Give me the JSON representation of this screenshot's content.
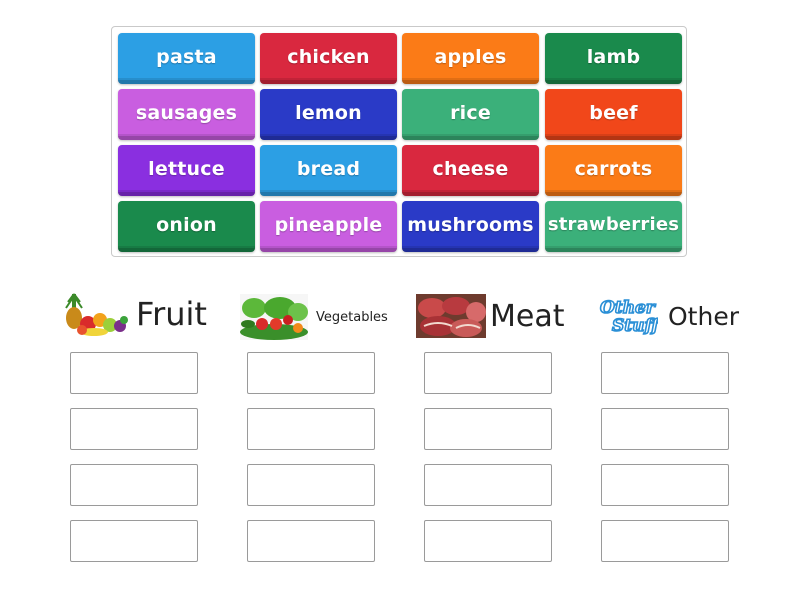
{
  "tiles": [
    {
      "label": "pasta",
      "color": "#2c9fe4"
    },
    {
      "label": "chicken",
      "color": "#d9283f"
    },
    {
      "label": "apples",
      "color": "#fb7b17"
    },
    {
      "label": "lamb",
      "color": "#1a8a4c"
    },
    {
      "label": "sausages",
      "color": "#c95ee0"
    },
    {
      "label": "lemon",
      "color": "#2a3ac7"
    },
    {
      "label": "rice",
      "color": "#3bb07a"
    },
    {
      "label": "beef",
      "color": "#f1471a"
    },
    {
      "label": "lettuce",
      "color": "#8a2fe0"
    },
    {
      "label": "bread",
      "color": "#2c9fe4"
    },
    {
      "label": "cheese",
      "color": "#d9283f"
    },
    {
      "label": "carrots",
      "color": "#fb7b17"
    },
    {
      "label": "onion",
      "color": "#1a8a4c"
    },
    {
      "label": "pineapple",
      "color": "#c95ee0"
    },
    {
      "label": "mushrooms",
      "color": "#2a3ac7"
    },
    {
      "label": "strawberries",
      "color": "#3bb07a"
    }
  ],
  "categories": [
    {
      "label": "Fruit",
      "icon": "fruit-image"
    },
    {
      "label": "Vegetables",
      "icon": "vegetables-image"
    },
    {
      "label": "Meat",
      "icon": "meat-image"
    },
    {
      "label": "Other",
      "icon": "other-stuff-logo",
      "logo_text": "Other Stuff"
    }
  ]
}
